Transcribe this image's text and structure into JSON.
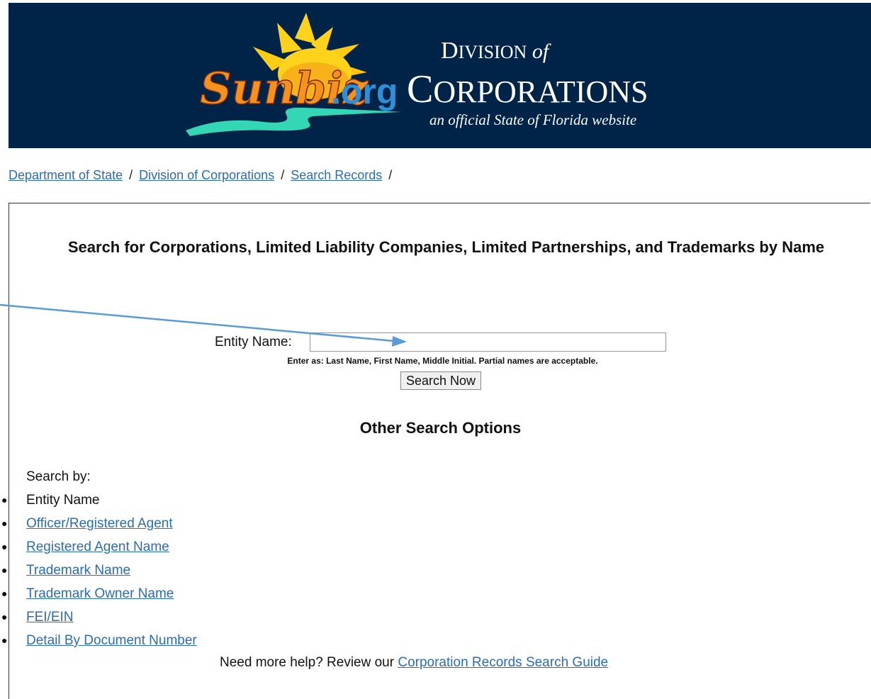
{
  "header": {
    "logo_text": "Sunbiz.org",
    "division_line1": "Division of",
    "division_line2": "Corporations",
    "tagline": "an official State of Florida website"
  },
  "breadcrumb": {
    "items": [
      {
        "label": "Department of State"
      },
      {
        "label": "Division of Corporations"
      },
      {
        "label": "Search Records"
      }
    ],
    "separator": "/"
  },
  "search": {
    "title": "Search for Corporations, Limited Liability Companies, Limited Partnerships, and Trademarks by Name",
    "entity_label": "Entity Name:",
    "entity_value": "",
    "hint": "Enter as: Last Name, First Name, Middle Initial. Partial names are acceptable.",
    "button_label": "Search Now"
  },
  "other_options": {
    "title": "Other Search Options",
    "search_by_label": "Search by:",
    "items": [
      {
        "label": "Entity Name",
        "is_link": false
      },
      {
        "label": "Officer/Registered Agent",
        "is_link": true
      },
      {
        "label": "Registered Agent Name",
        "is_link": true
      },
      {
        "label": "Trademark Name",
        "is_link": true
      },
      {
        "label": "Trademark Owner Name",
        "is_link": true
      },
      {
        "label": "FEI/EIN",
        "is_link": true
      },
      {
        "label": "Detail By Document Number",
        "is_link": true
      }
    ]
  },
  "help": {
    "prefix": "Need more help? Review our",
    "link_label": "Corporation Records Search Guide"
  },
  "colors": {
    "banner_bg": "#002447",
    "link": "#2a6db5",
    "annotation_arrow": "#5b9bd5"
  }
}
